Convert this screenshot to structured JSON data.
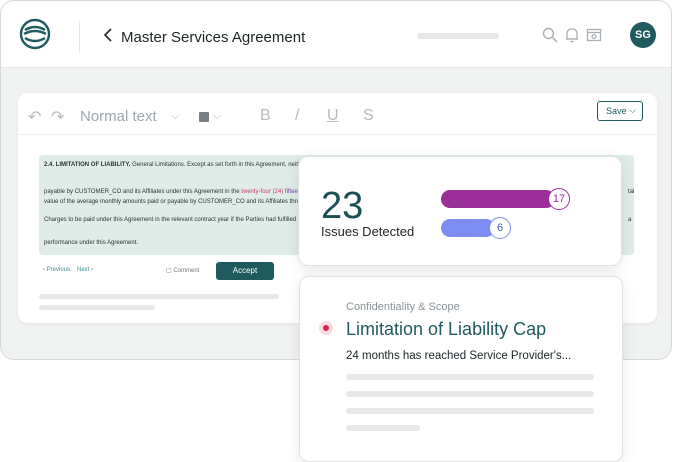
{
  "header": {
    "title": "Master Services Agreement",
    "avatar_initials": "SG"
  },
  "toolbar": {
    "text_style": "Normal text",
    "bold": "B",
    "italic": "/",
    "underline": "U",
    "strike": "S",
    "save_label": "Save"
  },
  "document": {
    "heading": "2.4. LIMITATION OF LIABILITY.",
    "line1_rest": " General Limitations. Except as set forth in this Agreement, neither Party",
    "line2_start": "payable by CUSTOMER_CO and its Affiliates under this Agreement in the ",
    "line2_removed": "twenty-four (24)",
    "line2_inserted": " fifteen (15) m",
    "line2_tail_right": "tal",
    "line3": "value of the average monthly amounts paid or payable by CUSTOMER_CO and its Affiliates through the",
    "line4": "Charges to be paid under this Agreement in the relevant contract year if the Parties had fulfilled the A",
    "line4_tail_right": "a",
    "line5": "performance under this Agreement.",
    "nav_previous": "Previous",
    "nav_next": "Next",
    "comment_label": "Comment",
    "accept_label": "Accept"
  },
  "summary": {
    "issues_count": "23",
    "issues_label": "Issues Detected",
    "bar_a_count": "17",
    "bar_b_count": "6"
  },
  "issue_card": {
    "category": "Confidentiality & Scope",
    "title": "Limitation of Liability Cap",
    "description": "24 months has reached Service Provider's..."
  },
  "colors": {
    "brand": "#1f5a5e",
    "bar_a": "#9b2f9a",
    "bar_b": "#7f8df3",
    "highlight": "#dfece8",
    "alert": "#d2274f"
  }
}
